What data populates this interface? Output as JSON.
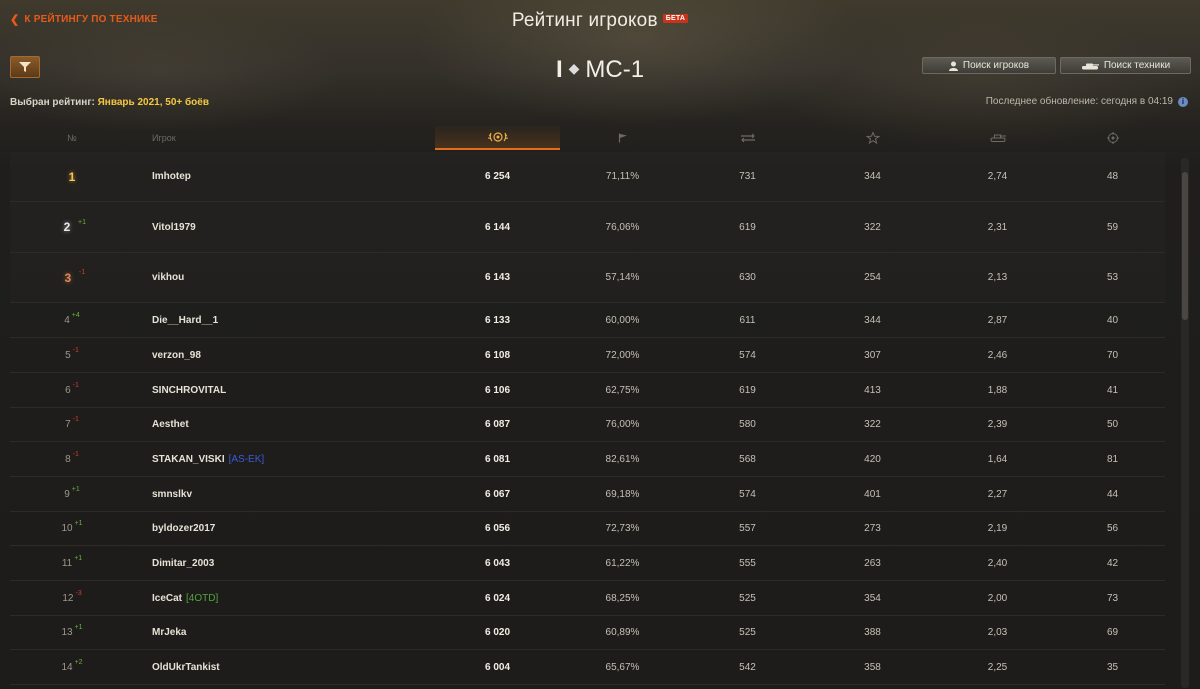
{
  "header": {
    "back_label": "К РЕЙТИНГУ ПО ТЕХНИКЕ",
    "title": "Рейтинг игроков",
    "beta": "БЕТА"
  },
  "tank": {
    "tier": "I",
    "name": "МС-1"
  },
  "toolbar": {
    "search_players": "Поиск игроков",
    "search_vehicles": "Поиск техники"
  },
  "selection": {
    "label": "Выбран рейтинг:",
    "value": "Январь 2021, 50+ боёв"
  },
  "update": {
    "label": "Последнее обновление: сегодня в 04:19",
    "info": "i"
  },
  "columns": {
    "rank": "№",
    "player": "Игрок",
    "icons": [
      "rating-laurel-icon",
      "flag-icon",
      "battles-icon",
      "star-icon",
      "damage-icon",
      "assist-icon"
    ]
  },
  "colors": {
    "accent": "#e26d1c",
    "highlight": "#f5c841",
    "up": "#6bb33a",
    "down": "#d23c2a",
    "clan_blue": "#3b5bd6",
    "clan_green": "#4ea63c"
  },
  "rows": [
    {
      "rank": "1",
      "medal": "gold",
      "delta": "",
      "player": "Imhotep",
      "clan": "",
      "rating": "6 254",
      "wins": "71,11%",
      "battles": "731",
      "xp": "344",
      "dmg": "2,74",
      "assist": "48"
    },
    {
      "rank": "2",
      "medal": "silver",
      "delta": "+1",
      "player": "Vitol1979",
      "clan": "",
      "rating": "6 144",
      "wins": "76,06%",
      "battles": "619",
      "xp": "322",
      "dmg": "2,31",
      "assist": "59"
    },
    {
      "rank": "3",
      "medal": "bronze",
      "delta": "-1",
      "player": "vikhou",
      "clan": "",
      "rating": "6 143",
      "wins": "57,14%",
      "battles": "630",
      "xp": "254",
      "dmg": "2,13",
      "assist": "53"
    },
    {
      "rank": "4",
      "medal": "",
      "delta": "+4",
      "player": "Die__Hard__1",
      "clan": "",
      "rating": "6 133",
      "wins": "60,00%",
      "battles": "611",
      "xp": "344",
      "dmg": "2,87",
      "assist": "40"
    },
    {
      "rank": "5",
      "medal": "",
      "delta": "-1",
      "player": "verzon_98",
      "clan": "",
      "rating": "6 108",
      "wins": "72,00%",
      "battles": "574",
      "xp": "307",
      "dmg": "2,46",
      "assist": "70"
    },
    {
      "rank": "6",
      "medal": "",
      "delta": "-1",
      "player": "SINCHROVITAL",
      "clan": "",
      "rating": "6 106",
      "wins": "62,75%",
      "battles": "619",
      "xp": "413",
      "dmg": "1,88",
      "assist": "41"
    },
    {
      "rank": "7",
      "medal": "",
      "delta": "-1",
      "player": "Aesthet",
      "clan": "",
      "rating": "6 087",
      "wins": "76,00%",
      "battles": "580",
      "xp": "322",
      "dmg": "2,39",
      "assist": "50"
    },
    {
      "rank": "8",
      "medal": "",
      "delta": "-1",
      "player": "STAKAN_VISKI",
      "clan": "[AS-EK]",
      "clan_color": "#3b5bd6",
      "rating": "6 081",
      "wins": "82,61%",
      "battles": "568",
      "xp": "420",
      "dmg": "1,64",
      "assist": "81"
    },
    {
      "rank": "9",
      "medal": "",
      "delta": "+1",
      "player": "smnslkv",
      "clan": "",
      "rating": "6 067",
      "wins": "69,18%",
      "battles": "574",
      "xp": "401",
      "dmg": "2,27",
      "assist": "44"
    },
    {
      "rank": "10",
      "medal": "",
      "delta": "+1",
      "player": "byldozer2017",
      "clan": "",
      "rating": "6 056",
      "wins": "72,73%",
      "battles": "557",
      "xp": "273",
      "dmg": "2,19",
      "assist": "56"
    },
    {
      "rank": "11",
      "medal": "",
      "delta": "+1",
      "player": "Dimitar_2003",
      "clan": "",
      "rating": "6 043",
      "wins": "61,22%",
      "battles": "555",
      "xp": "263",
      "dmg": "2,40",
      "assist": "42"
    },
    {
      "rank": "12",
      "medal": "",
      "delta": "-3",
      "player": "IceCat",
      "clan": "[4OTD]",
      "clan_color": "#4ea63c",
      "rating": "6 024",
      "wins": "68,25%",
      "battles": "525",
      "xp": "354",
      "dmg": "2,00",
      "assist": "73"
    },
    {
      "rank": "13",
      "medal": "",
      "delta": "+1",
      "player": "MrJeka",
      "clan": "",
      "rating": "6 020",
      "wins": "60,89%",
      "battles": "525",
      "xp": "388",
      "dmg": "2,03",
      "assist": "69"
    },
    {
      "rank": "14",
      "medal": "",
      "delta": "+2",
      "player": "OldUkrTankist",
      "clan": "",
      "rating": "6 004",
      "wins": "65,67%",
      "battles": "542",
      "xp": "358",
      "dmg": "2,25",
      "assist": "35"
    }
  ]
}
